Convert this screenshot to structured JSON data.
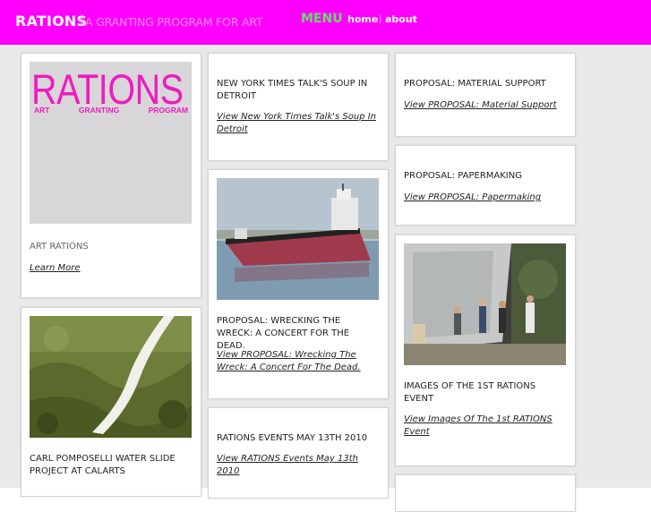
{
  "header": {
    "site_title": "RATIONS",
    "separator": "|",
    "tagline": "A GRANTING PROGRAM FOR ART",
    "menu_label": "MENU",
    "nav": [
      {
        "label": "home"
      },
      {
        "label": "about"
      }
    ]
  },
  "colors": {
    "brand": "#ff00ff",
    "menu": "#66dd66",
    "background": "#e9e9e9"
  },
  "cards": [
    {
      "logo_word": "RATIONS",
      "logo_sub": [
        "ART",
        "GRANTING",
        "PROGRAM"
      ],
      "title": "ART RATIONS",
      "link": "Learn More"
    },
    {
      "title": "CARL POMPOSELLI WATER SLIDE PROJECT AT CALARTS",
      "image": "water-slide-hillside-photo"
    },
    {
      "title": "NEW YORK TIMES TALK'S SOUP IN DETROIT",
      "link": "View New York Times Talk's Soup In Detroit"
    },
    {
      "title": "PROPOSAL: WRECKING THE WRECK: A CONCERT FOR THE DEAD.",
      "link": "View PROPOSAL: Wrecking The Wreck: A Concert For The Dead.",
      "image": "freighter-ship-photo"
    },
    {
      "title": "RATIONS EVENTS MAY 13TH 2010",
      "link": "View RATIONS Events May 13th 2010"
    },
    {
      "title": "PROPOSAL: MATERIAL SUPPORT",
      "link": "View PROPOSAL: Material Support"
    },
    {
      "title": "PROPOSAL: PAPERMAKING",
      "link": "View PROPOSAL: Papermaking"
    },
    {
      "title": "IMAGES OF THE 1ST RATIONS EVENT",
      "link": "View Images Of The 1st RATIONS Event",
      "image": "outdoor-event-crowd-photo"
    }
  ]
}
